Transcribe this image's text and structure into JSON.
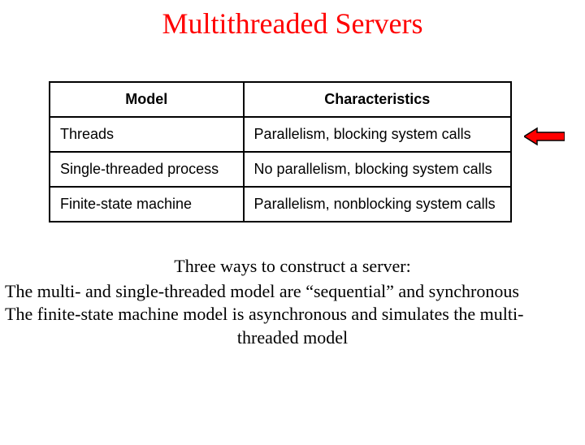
{
  "title": "Multithreaded Servers",
  "table": {
    "headers": {
      "model": "Model",
      "characteristics": "Characteristics"
    },
    "rows": [
      {
        "model": "Threads",
        "characteristics": "Parallelism, blocking system calls"
      },
      {
        "model": "Single-threaded process",
        "characteristics": "No parallelism, blocking system calls"
      },
      {
        "model": "Finite-state machine",
        "characteristics": "Parallelism, nonblocking system calls"
      }
    ]
  },
  "caption": {
    "line1": "Three ways to construct a server:",
    "line2": "The multi- and single-threaded model are “sequential” and synchronous",
    "line3": "The finite-state machine model is asynchronous and simulates the multi-",
    "line3b": "threaded model"
  },
  "icons": {
    "arrow": "left-arrow-icon"
  },
  "colors": {
    "title": "#ff0000",
    "arrow_fill": "#ff0000",
    "arrow_stroke": "#000000"
  }
}
